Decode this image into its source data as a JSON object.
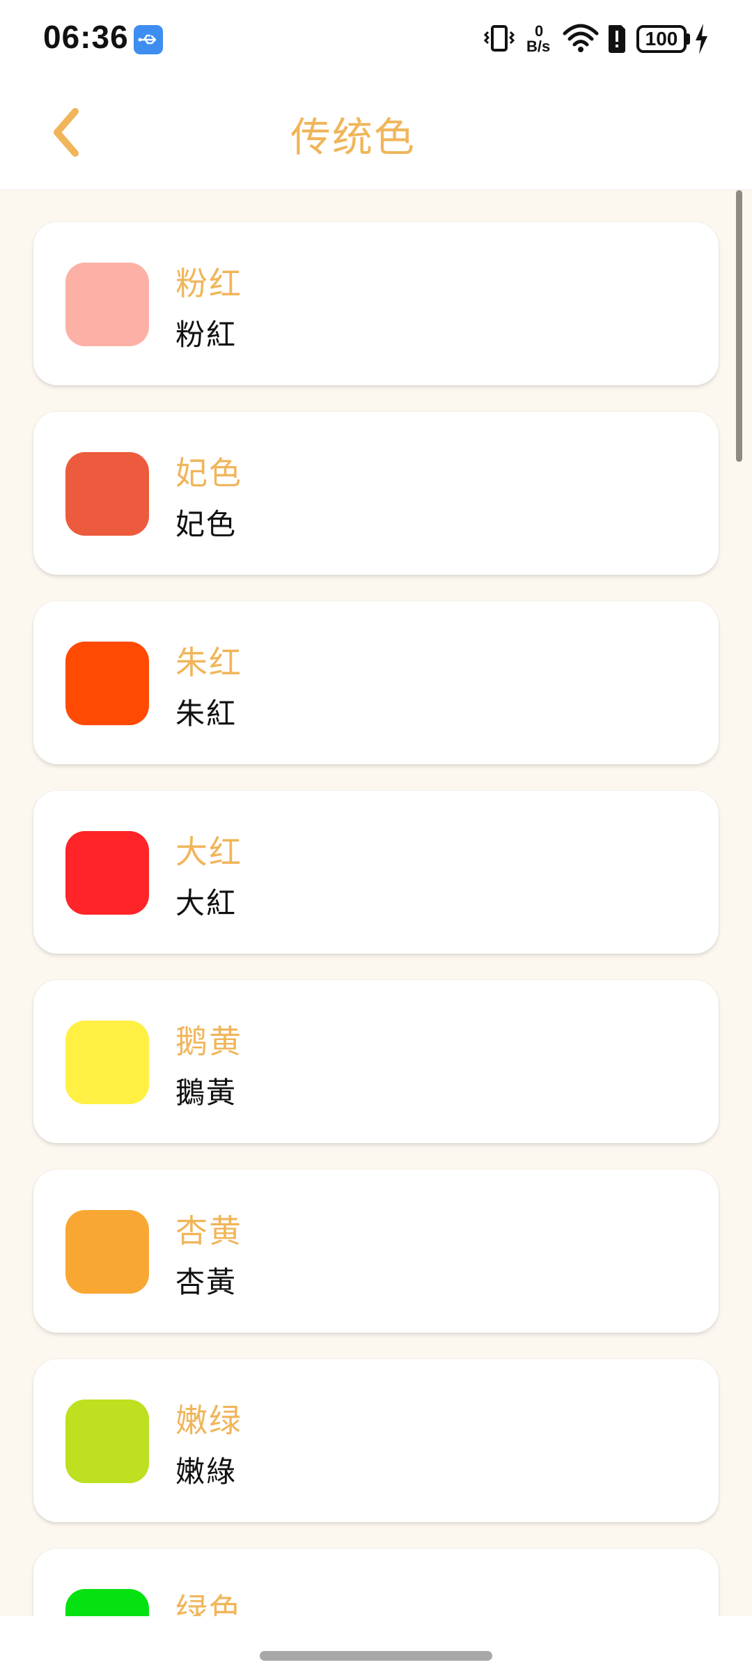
{
  "status_bar": {
    "time": "06:36",
    "net_speed_value": "0",
    "net_speed_unit": "B/s",
    "battery": "100",
    "icons": [
      "usb-icon",
      "vibrate-icon",
      "network-speed-icon",
      "wifi-icon",
      "alert-icon",
      "battery-icon",
      "charging-bolt-icon"
    ]
  },
  "header": {
    "title": "传统色",
    "back_icon": "chevron-left-icon",
    "accent_color": "#f0b55a"
  },
  "colors": [
    {
      "name": "粉红",
      "traditional": "粉紅",
      "hex": "#fdb0a5"
    },
    {
      "name": "妃色",
      "traditional": "妃色",
      "hex": "#ec5b3d"
    },
    {
      "name": "朱红",
      "traditional": "朱紅",
      "hex": "#fe4a03"
    },
    {
      "name": "大红",
      "traditional": "大紅",
      "hex": "#fe2427"
    },
    {
      "name": "鹅黄",
      "traditional": "鵝黃",
      "hex": "#fff043"
    },
    {
      "name": "杏黄",
      "traditional": "杏黃",
      "hex": "#f9a733"
    },
    {
      "name": "嫩绿",
      "traditional": "嫩綠",
      "hex": "#bde021"
    },
    {
      "name": "绿色",
      "traditional": "",
      "hex": "#06e111"
    }
  ],
  "theme": {
    "list_background": "#fcf8f0",
    "card_background": "#ffffff",
    "text_dark": "#111111"
  }
}
